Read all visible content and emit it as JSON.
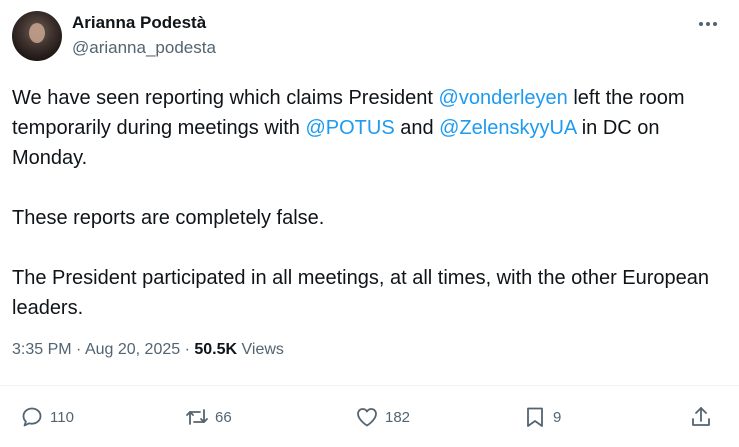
{
  "author": {
    "display_name": "Arianna Podestà",
    "handle": "@arianna_podesta"
  },
  "tweet": {
    "line1_prefix": "We have seen reporting which claims President ",
    "mention_1": "@vonderleyen",
    "line1_suffix": " left the room temporarily during meetings with ",
    "mention_2": "@POTUS",
    "and_text": " and ",
    "mention_3": "@ZelenskyyUA",
    "line1_end": " in DC on Monday.",
    "paragraph_2": "These reports are completely false.",
    "paragraph_3": "The President participated in all meetings, at all times, with the other European leaders."
  },
  "meta": {
    "time": "3:35 PM",
    "separator": " · ",
    "date": "Aug 20, 2025",
    "separator2": " · ",
    "views_count": "50.5K",
    "views_label": " Views"
  },
  "actions": {
    "replies": "110",
    "reposts": "66",
    "likes": "182",
    "bookmarks": "9"
  },
  "icons": {
    "more": "more-horizontal-icon",
    "reply": "reply-icon",
    "repost": "repost-icon",
    "like": "heart-icon",
    "bookmark": "bookmark-icon",
    "share": "share-icon"
  },
  "colors": {
    "link": "#1d9bf0",
    "text": "#0f1419",
    "secondary": "#536471"
  }
}
